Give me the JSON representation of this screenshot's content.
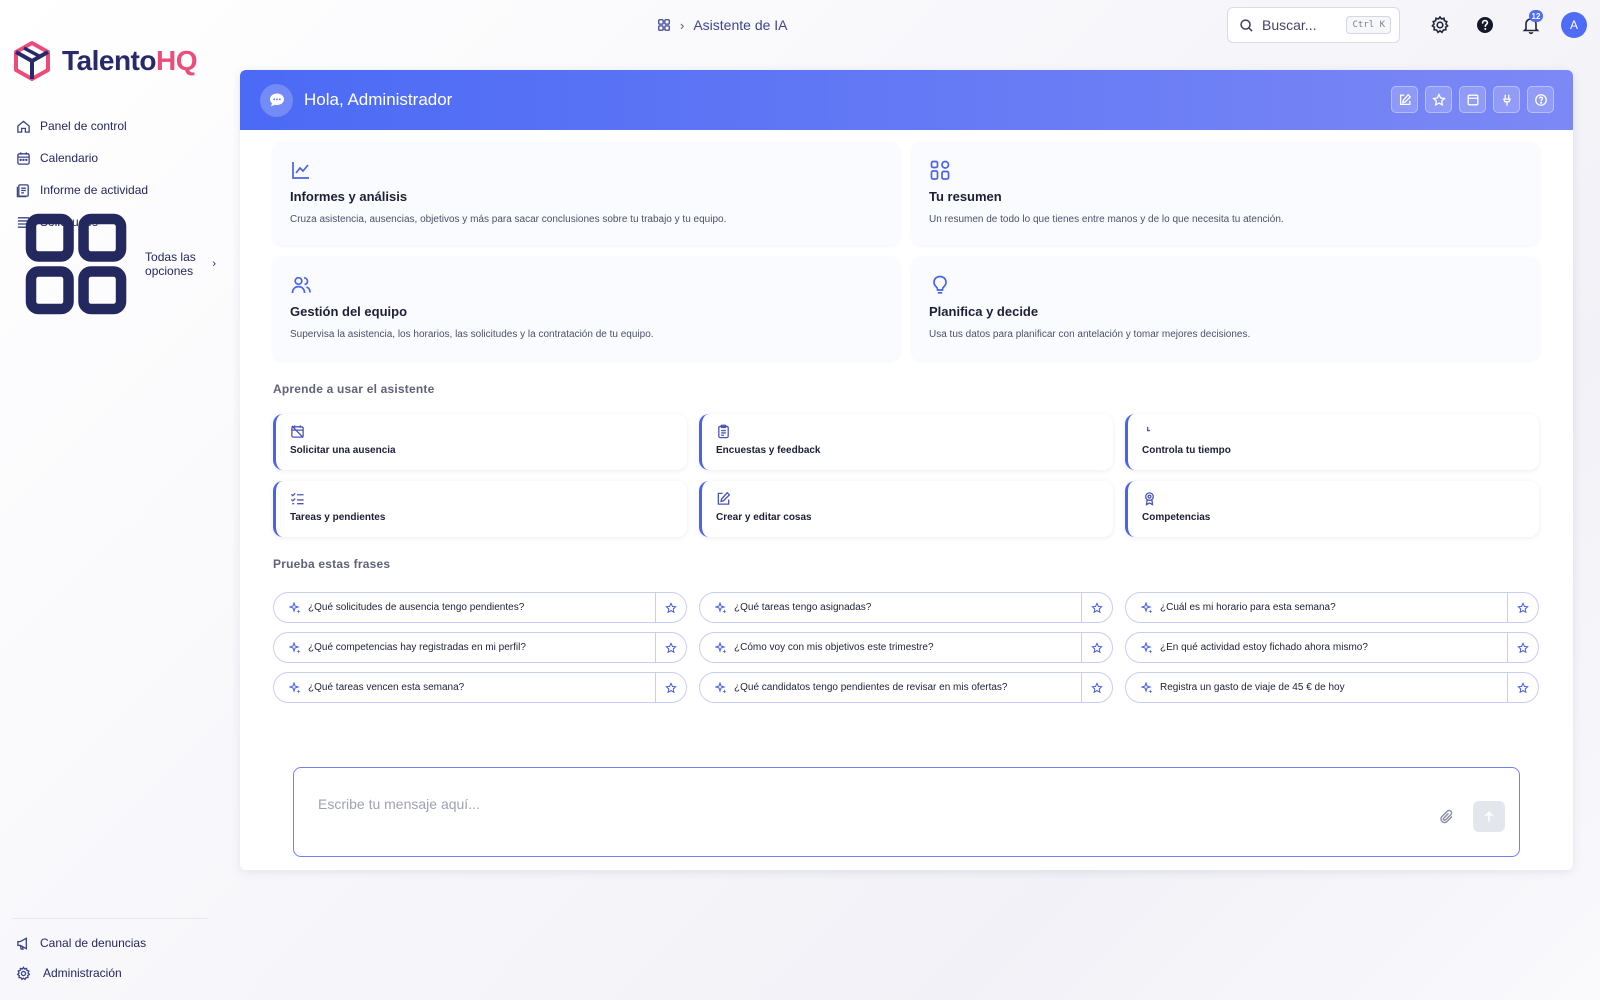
{
  "brand": {
    "name_part1": "Talento",
    "name_part2": "HQ",
    "primary": "#262a6b",
    "accent": "#ec4c7a"
  },
  "sidebar": {
    "items": [
      {
        "label": "Panel de control",
        "icon": "home-icon"
      },
      {
        "label": "Calendario",
        "icon": "calendar-icon"
      },
      {
        "label": "Informe de actividad",
        "icon": "activity-report-icon"
      },
      {
        "label": "Solicitudes",
        "icon": "requests-icon"
      }
    ],
    "all_options": {
      "label": "Todas las opciones",
      "icon": "grid-icon"
    },
    "bottom": [
      {
        "label": "Canal de denuncias",
        "icon": "megaphone-icon"
      },
      {
        "label": "Administración",
        "icon": "gear-icon"
      }
    ]
  },
  "topbar": {
    "breadcrumb": {
      "current": "Asistente de IA"
    },
    "search": {
      "placeholder": "Buscar...",
      "shortcut": "Ctrl K"
    },
    "notifications_count": "12",
    "avatar_initial": "A"
  },
  "panel": {
    "greeting": "Hola, Administrador",
    "header_tools": [
      "edit-icon",
      "star-icon",
      "window-icon",
      "pin-icon",
      "help-icon"
    ],
    "cards": [
      {
        "title": "Informes y análisis",
        "desc": "Cruza asistencia, ausencias, objetivos y más para sacar conclusiones sobre tu trabajo y tu equipo.",
        "icon": "line-chart-icon"
      },
      {
        "title": "Tu resumen",
        "desc": "Un resumen de todo lo que tienes entre manos y de lo que necesita tu atención.",
        "icon": "dashboard-icon"
      },
      {
        "title": "Gestión del equipo",
        "desc": "Supervisa la asistencia, los horarios, las solicitudes y la contratación de tu equipo.",
        "icon": "users-icon"
      },
      {
        "title": "Planifica y decide",
        "desc": "Usa tus datos para planificar con antelación y tomar mejores decisiones.",
        "icon": "lightbulb-icon"
      }
    ],
    "learn_title": "Aprende a usar el asistente",
    "learn": [
      {
        "label": "Solicitar una ausencia",
        "icon": "calendar-off-icon"
      },
      {
        "label": "Encuestas y feedback",
        "icon": "clipboard-icon"
      },
      {
        "label": "Controla tu tiempo",
        "icon": "clock-icon"
      },
      {
        "label": "Tareas y pendientes",
        "icon": "checklist-icon"
      },
      {
        "label": "Crear y editar cosas",
        "icon": "edit-icon"
      },
      {
        "label": "Competencias",
        "icon": "award-icon"
      }
    ],
    "phrases_title": "Prueba estas frases",
    "phrases": [
      "¿Qué solicitudes de ausencia tengo pendientes?",
      "¿Qué tareas tengo asignadas?",
      "¿Cuál es mi horario para esta semana?",
      "¿Qué competencias hay registradas en mi perfil?",
      "¿Cómo voy con mis objetivos este trimestre?",
      "¿En qué actividad estoy fichado ahora mismo?",
      "¿Qué tareas vencen esta semana?",
      "¿Qué candidatos tengo pendientes de revisar en mis ofertas?",
      "Registra un gasto de viaje de 45 € de hoy"
    ],
    "composer": {
      "placeholder": "Escribe tu mensaje aquí..."
    }
  },
  "colors": {
    "header_start": "#4b6af5",
    "header_end": "#7c88f5",
    "accent_blue": "#4b63e8"
  }
}
